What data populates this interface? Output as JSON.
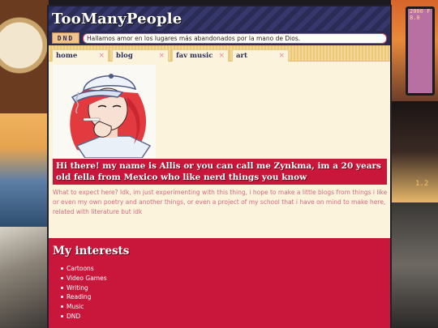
{
  "site": {
    "title": "TooManyPeople"
  },
  "marquee": {
    "tag": "DND",
    "text": "Hallamos amor en los lugares más abandonados por la mano de Dios."
  },
  "tabs": [
    {
      "label": "home",
      "close": "×"
    },
    {
      "label": "blog",
      "close": "×"
    },
    {
      "label": "fav music",
      "close": "×"
    },
    {
      "label": "art",
      "close": "×"
    }
  ],
  "intro": {
    "heading": "Hi there! my name is Allis or you can call me Zynkma, im a 20 years old fella from Mexico who like nerd things you know",
    "body": "What to expect here? Idk, im just experimenting with this thing, i hope to make a little blogs from things i like or even my own poetry and another things, or even a project of my school that i have on mind to make here, related with literature but idk"
  },
  "interests": {
    "title": "My interests",
    "items": [
      "Cartoons",
      "Video Games",
      "Writing",
      "Reading",
      "Music",
      "DND"
    ]
  },
  "background": {
    "film_number_top": "2000 F 8.0",
    "film_number_mid": "1.2"
  },
  "colors": {
    "accent_red": "#c8173a",
    "navy": "#2b2c56",
    "cream": "#fbf3dc",
    "pink_text": "#d46b7f"
  }
}
